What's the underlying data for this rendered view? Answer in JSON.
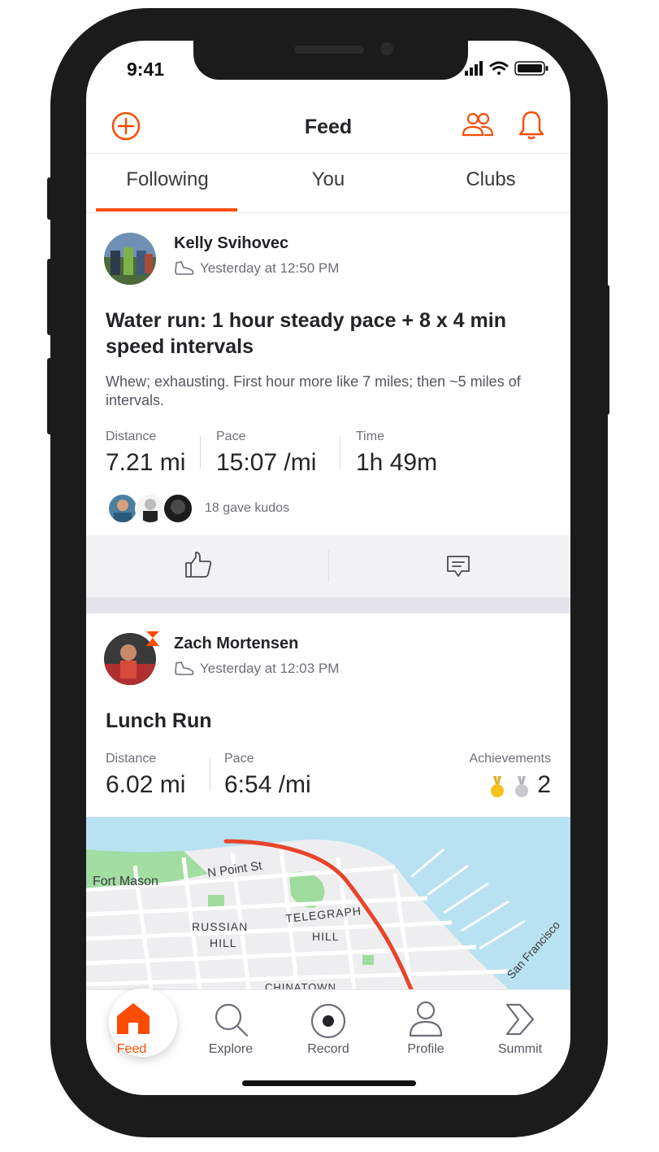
{
  "status_bar": {
    "time": "9:41"
  },
  "header": {
    "title": "Feed"
  },
  "tabs": [
    {
      "label": "Following",
      "active": true
    },
    {
      "label": "You",
      "active": false
    },
    {
      "label": "Clubs",
      "active": false
    }
  ],
  "posts": [
    {
      "athlete": "Kelly Svihovec",
      "timestamp": "Yesterday at 12:50 PM",
      "title": "Water run: 1 hour steady pace + 8 x 4 min speed intervals",
      "description": "Whew; exhausting. First hour more like 7 miles; then ~5 miles of intervals.",
      "stats": [
        {
          "label": "Distance",
          "value": "7.21 mi"
        },
        {
          "label": "Pace",
          "value": "15:07 /mi"
        },
        {
          "label": "Time",
          "value": "1h 49m"
        }
      ],
      "kudos": "18 gave kudos"
    },
    {
      "athlete": "Zach Mortensen",
      "timestamp": "Yesterday at 12:03 PM",
      "title": "Lunch Run",
      "stats": [
        {
          "label": "Distance",
          "value": "6.02 mi"
        },
        {
          "label": "Pace",
          "value": "6:54 /mi"
        }
      ],
      "achievements": {
        "label": "Achievements",
        "count": "2"
      },
      "map": {
        "labels": {
          "fort_mason": "Fort Mason",
          "n_point": "N Point St",
          "russian": "RUSSIAN",
          "russian_hill": "HILL",
          "telegraph": "TELEGRAPH",
          "telegraph_hill": "HILL",
          "sf": "San Francisco",
          "chinatown": "CHINATOWN"
        }
      }
    }
  ],
  "bottom_nav": [
    {
      "label": "Feed",
      "icon": "home-icon",
      "active": true
    },
    {
      "label": "Explore",
      "icon": "search-icon"
    },
    {
      "label": "Record",
      "icon": "record-icon"
    },
    {
      "label": "Profile",
      "icon": "profile-icon"
    },
    {
      "label": "Summit",
      "icon": "summit-icon"
    }
  ],
  "colors": {
    "accent": "#fc4c02",
    "water": "#b8e2f2",
    "park": "#8fd88f",
    "gold": "#f5c21a",
    "silver": "#c9c9cf"
  }
}
